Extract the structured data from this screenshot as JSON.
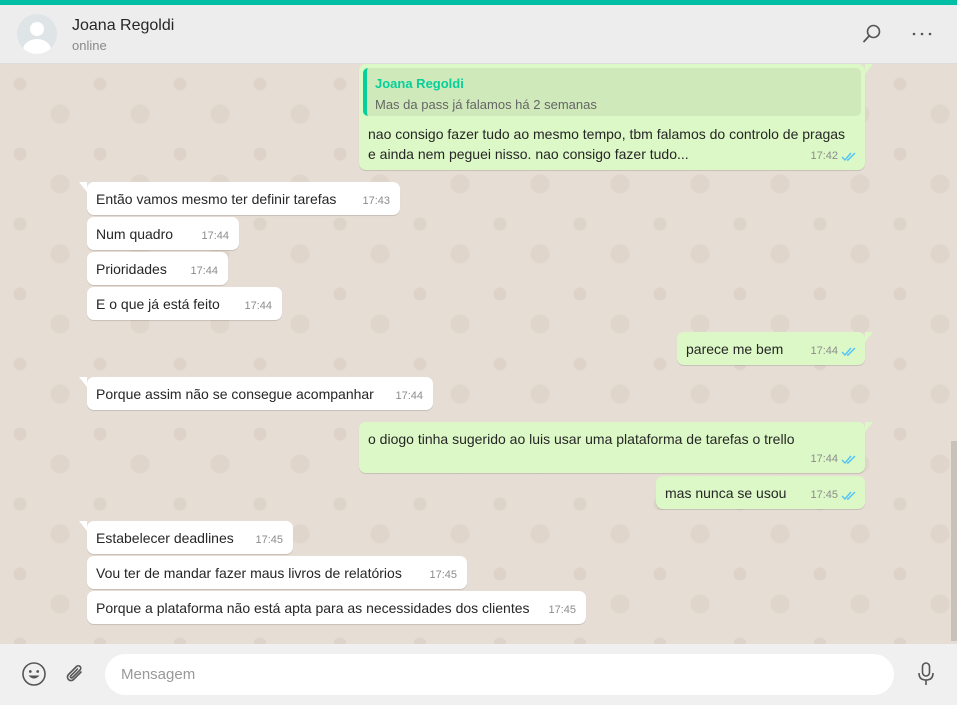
{
  "header": {
    "contact_name": "Joana Regoldi",
    "status": "online",
    "search_icon": "search-icon",
    "menu_icon": "more-horizontal-icon"
  },
  "colors": {
    "accent": "#00bfa5",
    "outgoing_bubble": "#dcf8c6",
    "incoming_bubble": "#ffffff",
    "read_tick": "#4fc3f7",
    "quote_name": "#06cf9c"
  },
  "messages": [
    {
      "direction": "out",
      "quote": {
        "name": "Joana Regoldi",
        "text": "Mas da pass já falamos há 2 semanas"
      },
      "lines": [
        "nao consigo fazer tudo ao mesmo tempo, tbm falamos do controlo de pragas",
        "e ainda nem peguei nisso. nao consigo fazer tudo..."
      ],
      "time": "17:42",
      "read": true
    },
    {
      "direction": "in",
      "text": "Então vamos mesmo ter definir tarefas",
      "time": "17:43"
    },
    {
      "direction": "in",
      "text": "Num quadro",
      "time": "17:44"
    },
    {
      "direction": "in",
      "text": "Prioridades",
      "time": "17:44"
    },
    {
      "direction": "in",
      "text": "E o que já está feito",
      "time": "17:44"
    },
    {
      "direction": "out",
      "text": "parece me bem",
      "time": "17:44",
      "read": true
    },
    {
      "direction": "in",
      "text": "Porque assim não se consegue acompanhar",
      "time": "17:44"
    },
    {
      "direction": "out",
      "text": "o diogo tinha sugerido ao luis usar uma plataforma de tarefas o trello",
      "time": "17:44",
      "read": true
    },
    {
      "direction": "out",
      "text": "mas nunca se usou",
      "time": "17:45",
      "read": true
    },
    {
      "direction": "in",
      "text": "Estabelecer deadlines",
      "time": "17:45"
    },
    {
      "direction": "in",
      "text": "Vou ter de mandar fazer maus livros de relatórios",
      "time": "17:45"
    },
    {
      "direction": "in",
      "text": "Porque a plataforma não está apta para as necessidades dos clientes",
      "time": "17:45"
    }
  ],
  "composer": {
    "placeholder": "Mensagem",
    "emoji_icon": "emoji-icon",
    "attach_icon": "paperclip-icon",
    "mic_icon": "microphone-icon"
  }
}
